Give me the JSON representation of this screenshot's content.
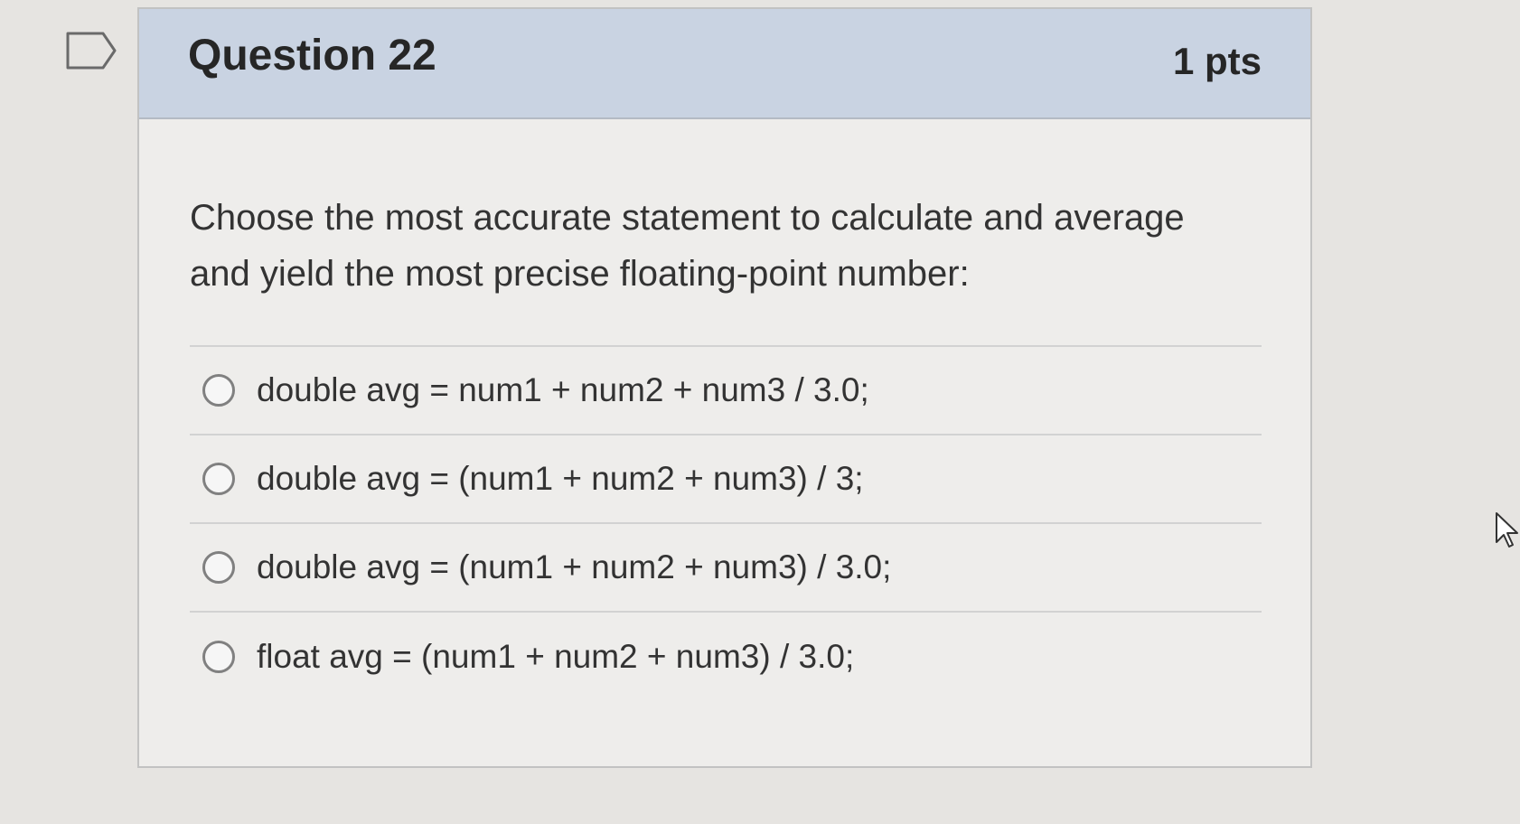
{
  "question": {
    "title": "Question 22",
    "points": "1 pts",
    "text": "Choose the most accurate statement to calculate and average and yield the most precise floating-point number:"
  },
  "answers": [
    {
      "label": "double avg = num1 + num2 + num3 / 3.0;",
      "selected": false
    },
    {
      "label": "double avg = (num1 + num2 + num3) / 3;",
      "selected": false
    },
    {
      "label": "double avg = (num1 + num2 + num3) / 3.0;",
      "selected": false
    },
    {
      "label": "float avg = (num1 + num2 + num3) / 3.0;",
      "selected": false
    }
  ],
  "icons": {
    "flag": "flag-question-icon",
    "cursor": "mouse-pointer-icon"
  },
  "colors": {
    "header_background": "#c9d3e2",
    "page_background": "#e6e4e1",
    "card_background": "#eeedeb",
    "text": "#333333",
    "radio_border": "#808080"
  }
}
